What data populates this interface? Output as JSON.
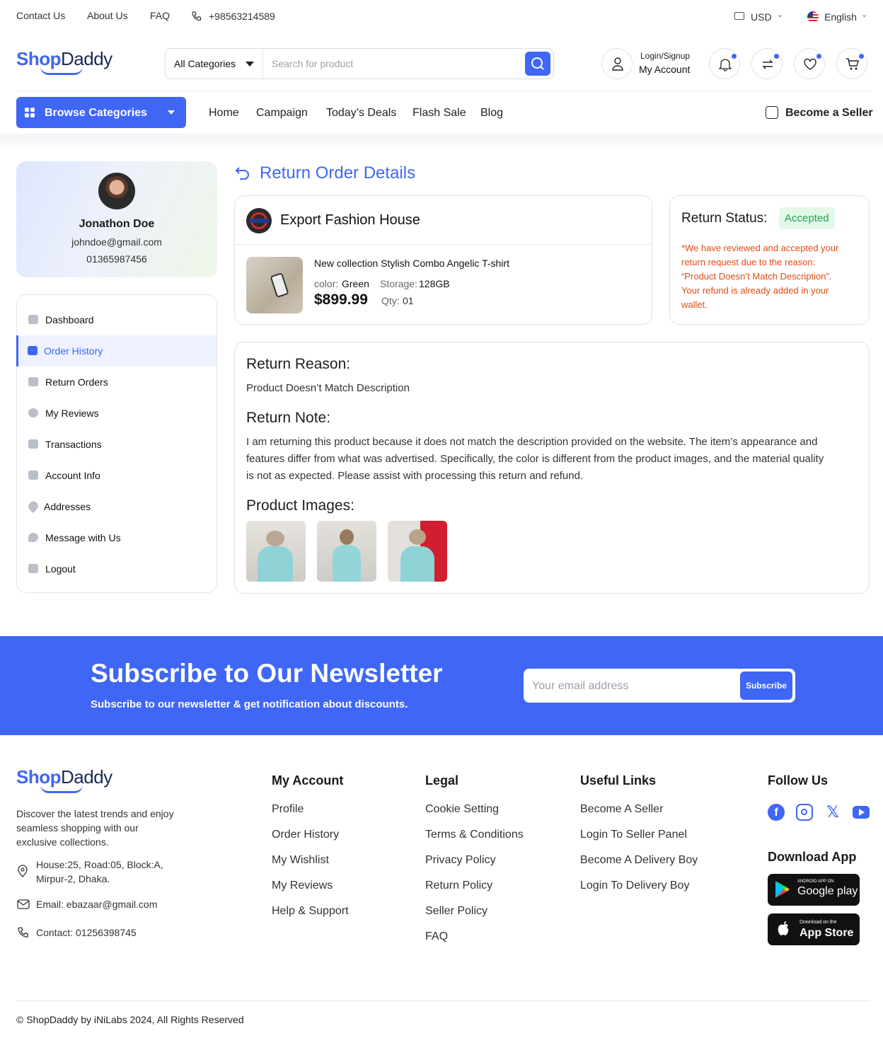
{
  "topbar": {
    "contact_us": "Contact Us",
    "about_us": "About Us",
    "faq": "FAQ",
    "phone": "+98563214589",
    "currency": "USD",
    "language": "English"
  },
  "header": {
    "logo_shop": "Shop",
    "logo_daddy": "Daddy",
    "category_select": "All Categories",
    "search_placeholder": "Search for product",
    "login_signup": "Login/Signup",
    "my_account": "My Account"
  },
  "nav": {
    "browse_categories": "Browse Categories",
    "items": [
      "Home",
      "Campaign",
      "Today’s Deals",
      "Flash Sale",
      "Blog"
    ],
    "become_seller": "Become a Seller"
  },
  "profile": {
    "name": "Jonathon Doe",
    "email": "johndoe@gmail.com",
    "phone": "01365987456"
  },
  "sidebar": {
    "items": [
      "Dashboard",
      "Order History",
      "Return Orders",
      "My Reviews",
      "Transactions",
      "Account Info",
      "Addresses",
      "Message with Us",
      "Logout"
    ],
    "active": "Order History"
  },
  "page": {
    "title": "Return Order Details"
  },
  "order": {
    "shop_name": "Export Fashion House",
    "product_name": "New collection Stylish Combo Angelic T-shirt",
    "color_label": "color:",
    "color_value": "Green",
    "storage_label": "Storage:",
    "storage_value": "128GB",
    "price": "$899.99",
    "qty_label": "Qty:",
    "qty_value": "01"
  },
  "return_status": {
    "label": "Return Status:",
    "status": "Accepted",
    "message_lines": [
      "*We have reviewed and accepted your",
      "return request due to the reason:",
      "“Product Doesn’t Match Description”.",
      "Your refund is already added in your",
      "wallet."
    ],
    "status_color": "#1aa34a",
    "message_color": "#e04a12"
  },
  "return_details": {
    "reason_heading": "Return Reason:",
    "reason": "Product Doesn’t Match Description",
    "note_heading": "Return Note:",
    "note_lines": [
      "I am returning this product because it does not match the description provided on the website. The item’s appearance and",
      "features differ from what was advertised. Specifically, the color is different from the product images, and the material quality",
      "is not as expected. Please assist with processing this return and refund."
    ],
    "images_heading": "Product Images:"
  },
  "newsletter": {
    "title": "Subscribe to Our Newsletter",
    "subtitle": "Subscribe to our newsletter & get notification about discounts.",
    "placeholder": "Your email address",
    "button": "Subscribe"
  },
  "footer": {
    "about_lines": [
      "Discover the latest trends and enjoy",
      "seamless shopping with our",
      "exclusive collections."
    ],
    "address_lines": [
      "House:25, Road:05, Block:A,",
      "Mirpur-2, Dhaka."
    ],
    "email": "Email: ebazaar@gmail.com",
    "contact": "Contact: 01256398745",
    "my_account": {
      "heading": "My Account",
      "links": [
        "Profile",
        "Order History",
        "My Wishlist",
        "My Reviews",
        "Help & Support"
      ]
    },
    "legal": {
      "heading": "Legal",
      "links": [
        "Cookie Setting",
        "Terms & Conditions",
        "Privacy Policy",
        "Return Policy",
        "Seller Policy",
        "FAQ"
      ]
    },
    "useful": {
      "heading": "Useful Links",
      "links": [
        "Become A Seller",
        "Login To Seller Panel",
        "Become A Delivery Boy",
        "Login To Delivery Boy"
      ]
    },
    "follow_us": "Follow Us",
    "download_app": "Download App",
    "google_small": "ANDROID APP ON",
    "google_big": "Google play",
    "apple_small": "Download on the",
    "apple_big": "App Store",
    "copyright": "© ShopDaddy by iNiLabs 2024, All Rights Reserved"
  },
  "colors": {
    "accent": "#3f66f5"
  }
}
